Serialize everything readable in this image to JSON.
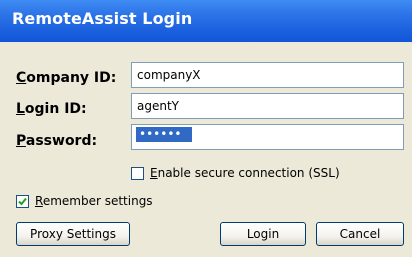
{
  "window": {
    "title": "RemoteAssist Login"
  },
  "form": {
    "company": {
      "label_mnemonic": "C",
      "label_rest": "ompany ID:",
      "value": "companyX"
    },
    "login": {
      "label_mnemonic": "L",
      "label_rest": "ogin ID:",
      "value": "agentY"
    },
    "password": {
      "label_mnemonic": "P",
      "label_rest": "assword:",
      "masked_value": "••••••"
    }
  },
  "options": {
    "ssl": {
      "checked": false,
      "label_mnemonic": "E",
      "label_rest": "nable secure connection (SSL)"
    },
    "remember": {
      "checked": true,
      "label_mnemonic": "R",
      "label_rest": "emember settings"
    }
  },
  "buttons": {
    "proxy": "Proxy Settings",
    "login": "Login",
    "cancel": "Cancel"
  },
  "colors": {
    "titlebar": "#0f55d8",
    "dialog_bg": "#ece9d8",
    "selection": "#316ac5",
    "checkmark": "#21a121"
  }
}
